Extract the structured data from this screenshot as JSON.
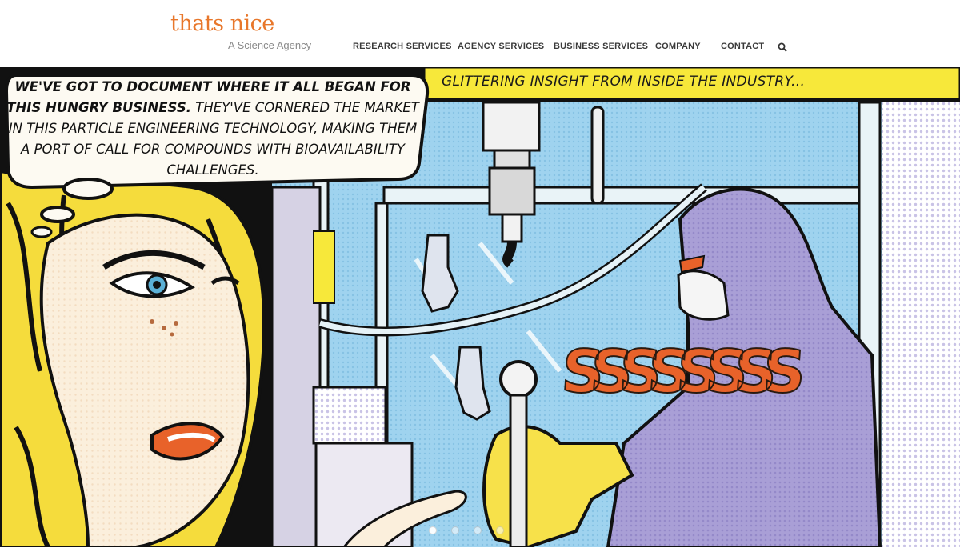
{
  "brand": {
    "logo_word": "thats nice",
    "tagline": "A Science Agency",
    "accent": "#e8772b"
  },
  "nav": {
    "items": [
      {
        "label": "RESEARCH SERVICES"
      },
      {
        "label": "AGENCY SERVICES"
      },
      {
        "label": "BUSINESS SERVICES"
      },
      {
        "label": "COMPANY"
      },
      {
        "label": "CONTACT"
      }
    ],
    "search_icon": "search-icon"
  },
  "hero": {
    "caption": "GLITTERING INSIGHT FROM INSIDE THE INDUSTRY...",
    "bubble_bold": "WE'VE GOT TO DOCUMENT WHERE IT ALL BEGAN FOR THIS HUNGRY BUSINESS.",
    "bubble_rest": "THEY'VE CORNERED THE MARKET IN THIS PARTICLE ENGINEERING TECHNOLOGY, MAKING THEM A PORT OF CALL FOR COMPOUNDS WITH BIOAVAILABILITY CHALLENGES.",
    "sfx": "SSSSSSSS",
    "colors": {
      "caption_yellow": "#f7e83a",
      "lab_blue": "#9fd3ef",
      "suit_purple": "#a99fd6",
      "hair_yellow": "#f5dc3c",
      "skin": "#fbefdc",
      "lips": "#e8622a"
    },
    "slider": {
      "count": 4,
      "active_index": 0
    }
  }
}
